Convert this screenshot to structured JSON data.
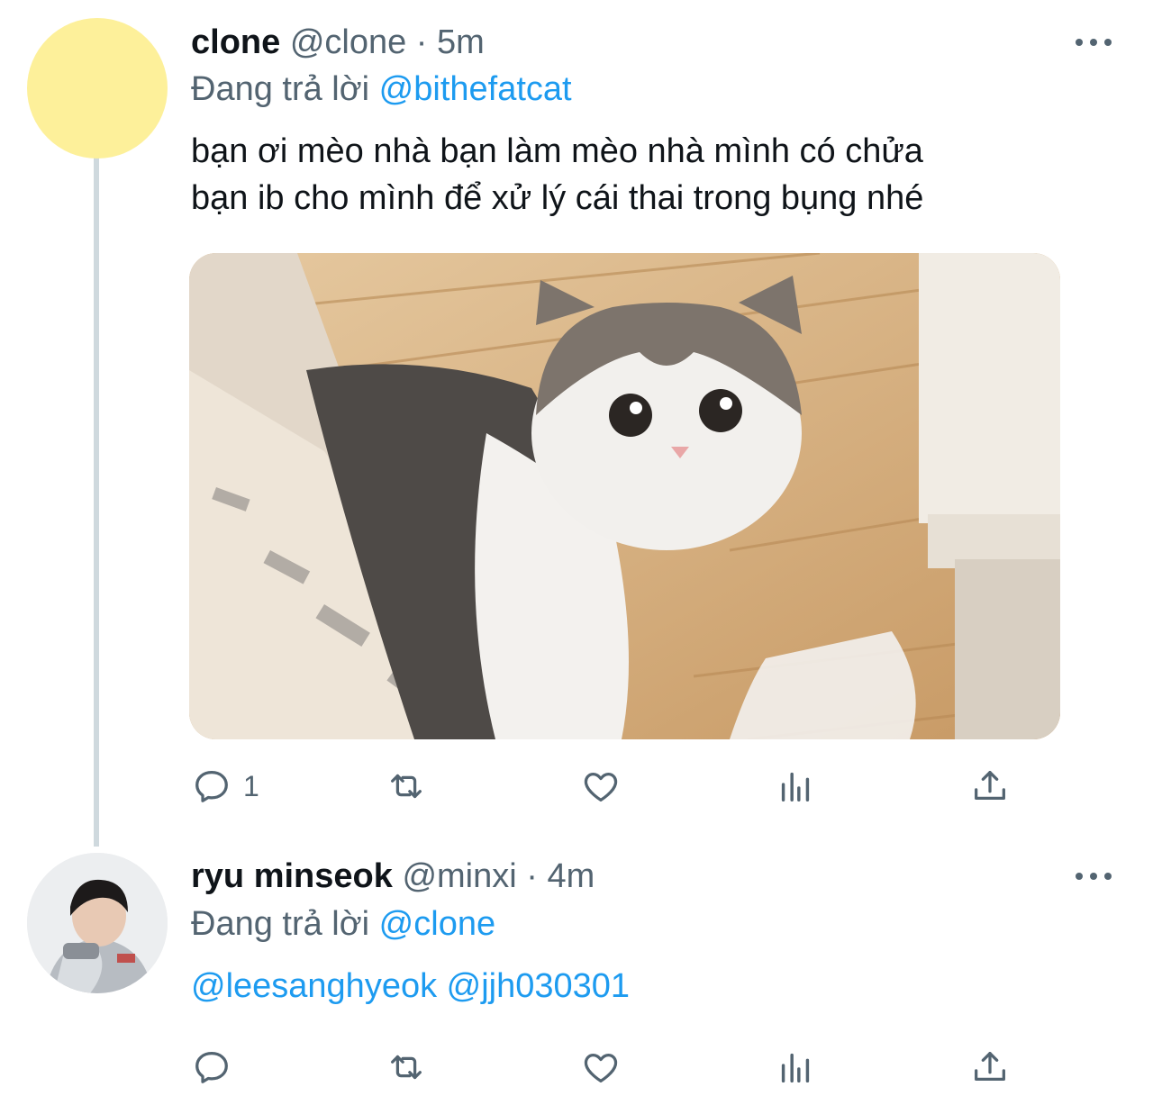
{
  "tweets": [
    {
      "name": "clone",
      "handle": "@clone",
      "separator": " · ",
      "time": "5m",
      "reply_prefix": "Đang trả lời ",
      "reply_to": "@bithefatcat",
      "text_line1": "bạn ơi mèo nhà bạn làm mèo nhà mình có chửa",
      "text_line2": "bạn ib cho mình để xử lý cái thai trong bụng nhé",
      "reply_count": "1",
      "avatar_color": "#fdf09a"
    },
    {
      "name": "ryu minseok",
      "handle": "@minxi",
      "separator": " · ",
      "time": "4m",
      "reply_prefix": "Đang trả lời ",
      "reply_to": "@clone",
      "mentions": [
        "@leesanghyeok",
        "@jjh030301"
      ],
      "reply_count": ""
    }
  ],
  "icons": [
    "more-icon",
    "reply-icon",
    "retweet-icon",
    "like-icon",
    "analytics-icon",
    "share-icon"
  ],
  "colors": {
    "link": "#1d9bf0",
    "secondary": "#536471",
    "thread_line": "#cfd9de"
  }
}
